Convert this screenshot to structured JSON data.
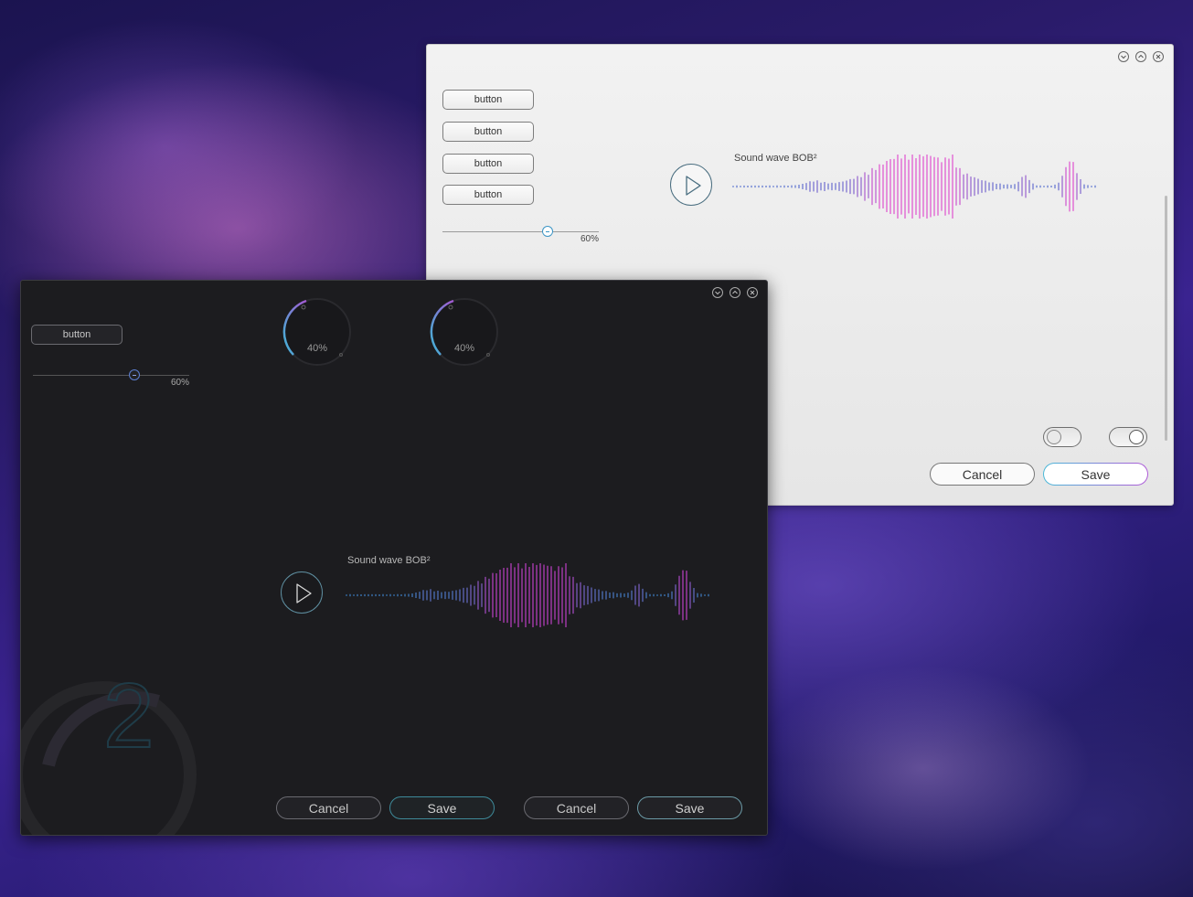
{
  "light_window": {
    "controls": {
      "minimize_icon": "chevron-down-icon",
      "maximize_icon": "chevron-up-icon",
      "close_icon": "close-icon"
    },
    "buttons": [
      "button",
      "button",
      "button",
      "button"
    ],
    "slider": {
      "value": 0.6,
      "label": "60%"
    },
    "player": {
      "title": "Sound wave BOB²",
      "play_icon": "play-icon"
    },
    "toggles": [
      {
        "state": "off"
      },
      {
        "state": "on"
      }
    ],
    "footer": {
      "cancel_label": "Cancel",
      "save_label": "Save"
    }
  },
  "dark_window": {
    "controls": {
      "minimize_icon": "chevron-down-icon",
      "maximize_icon": "chevron-up-icon",
      "close_icon": "close-icon"
    },
    "button_label": "button",
    "slider": {
      "value": 0.6,
      "label": "60%"
    },
    "knobs": [
      {
        "value": 0.4,
        "label": "40%"
      },
      {
        "value": 0.4,
        "label": "40%"
      }
    ],
    "player": {
      "title": "Sound wave BOB²",
      "play_icon": "play-icon"
    },
    "footer_left": {
      "cancel_label": "Cancel",
      "save_label": "Save"
    },
    "footer_right": {
      "cancel_label": "Cancel",
      "save_label": "Save"
    },
    "deco_digit": "2"
  },
  "colors": {
    "accent_cyan": "#49b9d8",
    "accent_magenta": "#b05ad8",
    "dark_bg": "#1c1c1f",
    "light_bg": "#eeeeee"
  }
}
